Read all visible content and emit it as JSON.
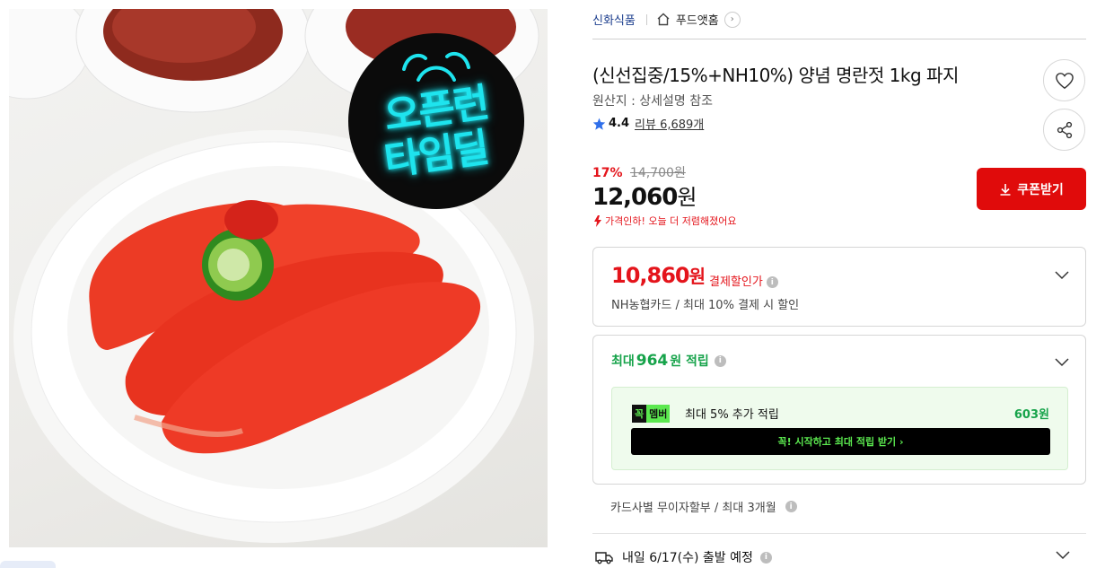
{
  "breadcrumb": {
    "seller": "신화식품",
    "store": "푸드앳홈",
    "arrow": "›"
  },
  "badge": {
    "line1": "오픈런",
    "line2": "타임딜"
  },
  "product": {
    "title": "(신선집중/15%+NH10%) 양념 명란젓 1kg 파지",
    "origin": "원산지 : 상세설명 참조",
    "rating": "4.4",
    "reviews": "리뷰 6,689개"
  },
  "price": {
    "discount_rate": "17%",
    "original": "14,700원",
    "sale": "12,060",
    "won": "원",
    "note": "가격인하! 오늘 더 저렴해졌어요"
  },
  "coupon_button": "쿠폰받기",
  "card_discount": {
    "price": "10,860",
    "won": "원",
    "label": "결제할인가",
    "sub": "NH농협카드 / 최대 10% 결제 시 할인"
  },
  "points": {
    "prefix": "최대",
    "amount": "964",
    "suffix": "원 적립",
    "member_tag_dark": "꼭",
    "member_tag_green": "멤버",
    "member_text": "최대 5% 추가 적립",
    "member_points": "603원",
    "cta": "꼭! 시작하고 최대 적립 받기  ›"
  },
  "installment": "카드사별 무이자할부 / 최대 3개월",
  "shipping": "내일 6/17(수) 출발 예정",
  "info_glyph": "i",
  "colors": {
    "accent_red": "#e00b0b",
    "sale_red": "#e4141b",
    "points_green": "#16a34a",
    "member_neon": "#5be84f",
    "seller_blue": "#1d3f8e"
  },
  "icons": [
    "home-icon",
    "heart-icon",
    "share-icon",
    "star-icon",
    "download-icon",
    "chevron-down-icon",
    "truck-icon",
    "info-icon",
    "alarm-clock-icon"
  ]
}
